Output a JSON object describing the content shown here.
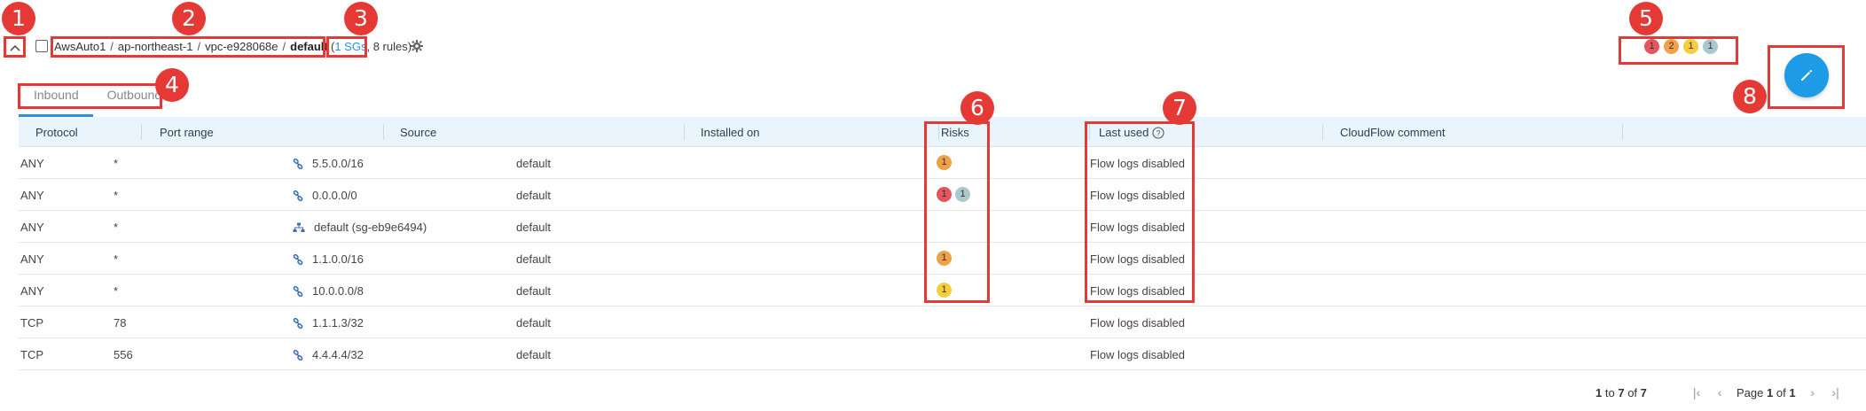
{
  "header": {
    "breadcrumb": [
      "AwsAuto1",
      "ap-northeast-1",
      "vpc-e928068e",
      "default"
    ],
    "sgs_link": "1 SGs",
    "sgs_suffix": ", 8 rules)",
    "sgs_prefix": "(",
    "collapse_icon": "chevron-up-icon",
    "settings_icon": "gear-icon"
  },
  "risk_summary": [
    {
      "count": "1",
      "color": "#e2565c"
    },
    {
      "count": "2",
      "color": "#f0a046"
    },
    {
      "count": "1",
      "color": "#f6ce3c"
    },
    {
      "count": "1",
      "color": "#a9c9cc"
    }
  ],
  "edit_button": {
    "icon": "pencil-icon",
    "color": "#1e9be6"
  },
  "tabs": [
    {
      "label": "Inbound",
      "active": true
    },
    {
      "label": "Outbound",
      "active": false
    }
  ],
  "table": {
    "columns": [
      "Protocol",
      "Port range",
      "Source",
      "Installed on",
      "Risks",
      "Last used",
      "CloudFlow comment"
    ],
    "rows": [
      {
        "protocol": "ANY",
        "port": "*",
        "source": "5.5.0.0/16",
        "source_icon": "link-icon",
        "installed": "default",
        "risks": [
          {
            "count": "1",
            "color": "#f0a046"
          }
        ],
        "last_used": "Flow logs disabled"
      },
      {
        "protocol": "ANY",
        "port": "*",
        "source": "0.0.0.0/0",
        "source_icon": "link-icon",
        "installed": "default",
        "risks": [
          {
            "count": "1",
            "color": "#e2565c"
          },
          {
            "count": "1",
            "color": "#a9c9cc"
          }
        ],
        "last_used": "Flow logs disabled"
      },
      {
        "protocol": "ANY",
        "port": "*",
        "source": "default (sg-eb9e6494)",
        "source_icon": "network-icon",
        "installed": "default",
        "risks": [],
        "last_used": "Flow logs disabled"
      },
      {
        "protocol": "ANY",
        "port": "*",
        "source": "1.1.0.0/16",
        "source_icon": "link-icon",
        "installed": "default",
        "risks": [
          {
            "count": "1",
            "color": "#f0a046"
          }
        ],
        "last_used": "Flow logs disabled"
      },
      {
        "protocol": "ANY",
        "port": "*",
        "source": "10.0.0.0/8",
        "source_icon": "link-icon",
        "installed": "default",
        "risks": [
          {
            "count": "1",
            "color": "#f6ce3c"
          }
        ],
        "last_used": "Flow logs disabled"
      },
      {
        "protocol": "TCP",
        "port": "78",
        "source": "1.1.1.3/32",
        "source_icon": "link-icon",
        "installed": "default",
        "risks": [],
        "last_used": "Flow logs disabled"
      },
      {
        "protocol": "TCP",
        "port": "556",
        "source": "4.4.4.4/32",
        "source_icon": "link-icon",
        "installed": "default",
        "risks": [],
        "last_used": "Flow logs disabled"
      }
    ]
  },
  "pagination": {
    "from": "1",
    "to_word": "to",
    "to": "7",
    "of_word": "of",
    "total": "7",
    "page_word": "Page",
    "page": "1",
    "page_of": "of",
    "pages": "1"
  },
  "callouts": [
    "1",
    "2",
    "3",
    "4",
    "5",
    "6",
    "7",
    "8"
  ]
}
